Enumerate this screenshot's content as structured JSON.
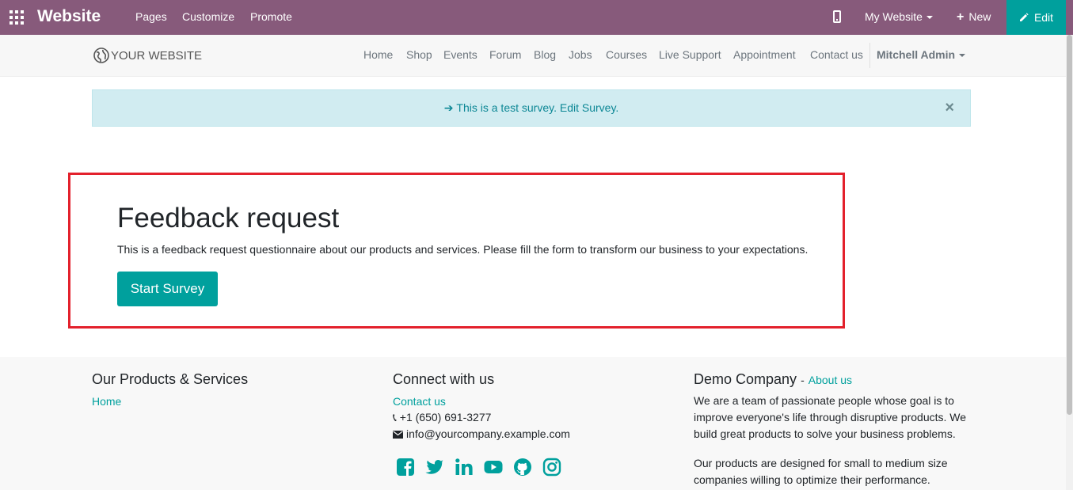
{
  "topbar": {
    "brand": "Website",
    "menu": [
      "Pages",
      "Customize",
      "Promote"
    ],
    "website_selector": "My Website",
    "new_label": "New",
    "edit_label": "Edit"
  },
  "navbar": {
    "logo_text": "YOUR WEBSITE",
    "links": [
      "Home",
      "Shop",
      "Events",
      "Forum",
      "Blog",
      "Jobs",
      "Courses",
      "Live Support",
      "Appointment",
      "Contact us"
    ],
    "user": "Mitchell Admin"
  },
  "alert": {
    "text": "This is a test survey. Edit Survey.",
    "close": "×"
  },
  "survey": {
    "title": "Feedback request",
    "description": "This is a feedback request questionnaire about our products and services. Please fill the form to transform our business to your expectations.",
    "start_button": "Start Survey"
  },
  "footer": {
    "col1": {
      "heading": "Our Products & Services",
      "link": "Home"
    },
    "col2": {
      "heading": "Connect with us",
      "contact_link": "Contact us",
      "phone": "+1 (650) 691-3277",
      "email": "info@yourcompany.example.com"
    },
    "col3": {
      "heading": "Demo Company",
      "about_link": "About us",
      "para1": "We are a team of passionate people whose goal is to improve everyone's life through disruptive products. We build great products to solve your business problems.",
      "para2": "Our products are designed for small to medium size companies willing to optimize their performance."
    },
    "social_icons": [
      "facebook-icon",
      "twitter-icon",
      "linkedin-icon",
      "youtube-icon",
      "github-icon",
      "instagram-icon"
    ]
  },
  "colors": {
    "admin_bar": "#875a7b",
    "accent": "#00a09d",
    "highlight": "#e3212c",
    "alert_bg": "#d1ecf1"
  }
}
